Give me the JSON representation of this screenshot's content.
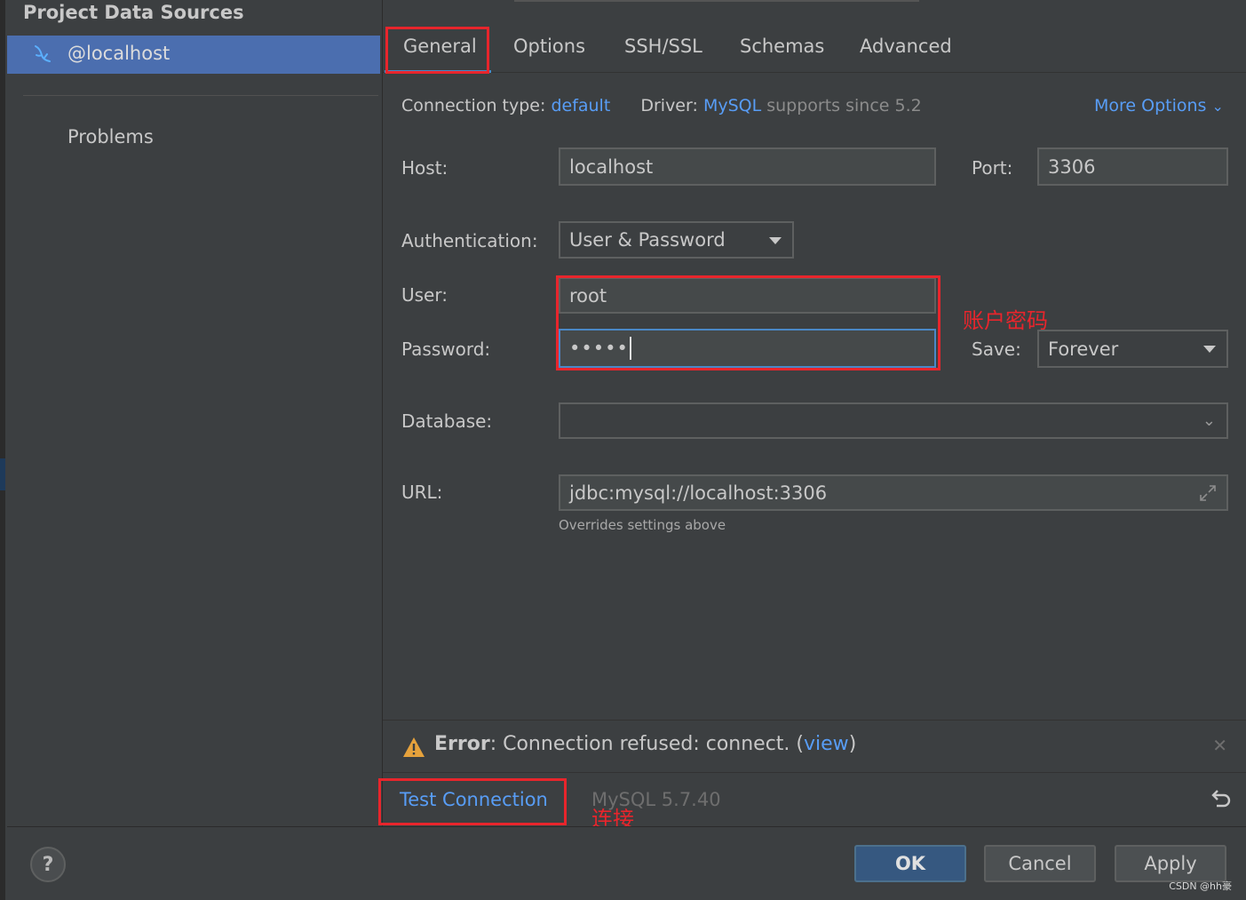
{
  "sidebar": {
    "title": "Project Data Sources",
    "data_source": "@localhost",
    "problems": "Problems"
  },
  "tabs": [
    "General",
    "Options",
    "SSH/SSL",
    "Schemas",
    "Advanced"
  ],
  "connection": {
    "type_label": "Connection type:",
    "type_value": "default",
    "driver_label": "Driver:",
    "driver_value": "MySQL",
    "driver_note": "supports since 5.2",
    "more_options": "More Options"
  },
  "form": {
    "host_label": "Host:",
    "host_value": "localhost",
    "port_label": "Port:",
    "port_value": "3306",
    "auth_label": "Authentication:",
    "auth_value": "User & Password",
    "user_label": "User:",
    "user_value": "root",
    "password_label": "Password:",
    "password_value": "•••••",
    "save_label": "Save:",
    "save_value": "Forever",
    "database_label": "Database:",
    "database_value": "",
    "url_label": "URL:",
    "url_value": "jdbc:mysql://localhost:3306",
    "url_hint": "Overrides settings above"
  },
  "annotations": {
    "credentials_note": "账户密码",
    "connect_note": "连接"
  },
  "error": {
    "label": "Error",
    "message": ": Connection refused: connect. (",
    "view_link": "view",
    "close_paren": ")"
  },
  "footer": {
    "test_connection": "Test Connection",
    "version": "MySQL 5.7.40"
  },
  "buttons": {
    "help": "?",
    "ok": "OK",
    "cancel": "Cancel",
    "apply": "Apply"
  },
  "watermark": "CSDN @hh豪",
  "colors": {
    "background": "#3c3f41",
    "selection": "#4b6eaf",
    "link": "#589df6",
    "annotation_red": "#e8252c",
    "ok_button": "#365880"
  }
}
